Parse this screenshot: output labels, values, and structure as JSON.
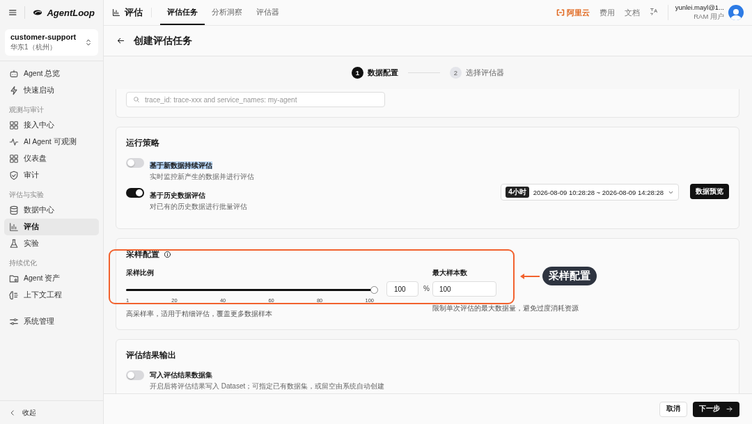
{
  "sidebar": {
    "brand": "AgentLoop",
    "project": {
      "name": "customer-support",
      "region": "华东1（杭州）"
    },
    "sections": [
      {
        "items": [
          {
            "label": "Agent 总览",
            "selected": false
          },
          {
            "label": "快速启动",
            "selected": false
          }
        ]
      },
      {
        "title": "观测与审计",
        "items": [
          {
            "label": "接入中心",
            "selected": false
          },
          {
            "label": "AI Agent 可观测",
            "selected": false
          },
          {
            "label": "仪表盘",
            "selected": false
          },
          {
            "label": "审计",
            "selected": false
          }
        ]
      },
      {
        "title": "评估与实验",
        "items": [
          {
            "label": "数据中心",
            "selected": false
          },
          {
            "label": "评估",
            "selected": true
          },
          {
            "label": "实验",
            "selected": false
          }
        ]
      },
      {
        "title": "持续优化",
        "items": [
          {
            "label": "Agent 资产",
            "selected": false
          },
          {
            "label": "上下文工程",
            "selected": false
          }
        ]
      },
      {
        "items": [
          {
            "label": "系统管理",
            "selected": false
          }
        ]
      }
    ],
    "collapse": "收起"
  },
  "topbar": {
    "section": "评估",
    "tabs": [
      {
        "label": "评估任务",
        "selected": true
      },
      {
        "label": "分析洞察",
        "selected": false
      },
      {
        "label": "评估器",
        "selected": false
      }
    ],
    "cloud_brand": "阿里云",
    "links": [
      "费用",
      "文档"
    ],
    "user": {
      "name": "yunlei.mayl@1...",
      "role": "RAM 用户"
    }
  },
  "page": {
    "title": "创建评估任务",
    "steps": [
      {
        "number": "1",
        "label": "数据配置",
        "selected": true
      },
      {
        "number": "2",
        "label": "选择评估器",
        "selected": false
      }
    ],
    "filter": {
      "placeholder": "trace_id: trace-xxx and service_names: my-agent"
    },
    "run_strategy": {
      "title": "运行策略",
      "options": [
        {
          "label": "基于新数据持续评估",
          "description": "实时监控新产生的数据并进行评估",
          "on": false,
          "text_selected": true
        },
        {
          "label": "基于历史数据评估",
          "description": "对已有的历史数据进行批量评估",
          "on": true,
          "text_selected": false
        }
      ],
      "time_range": {
        "badge": "4小时",
        "value": "2026-08-09 10:28:28 ~ 2026-08-09 14:28:28"
      },
      "preview_button": "数据预览"
    },
    "sampling": {
      "title": "采样配置",
      "ratio_label": "采样比例",
      "level": 1.0,
      "ticks": [
        "1",
        "20",
        "40",
        "60",
        "80",
        "100"
      ],
      "ratio_value": "100",
      "unit": "%",
      "ratio_hint": "高采样率，适用于精细评估，覆盖更多数据样本",
      "max_label": "最大样本数",
      "max_value": "100",
      "max_hint": "限制单次评估的最大数据量，避免过度消耗资源"
    },
    "output": {
      "title": "评估结果输出",
      "label": "写入评估结果数据集",
      "description": "开启后将评估结果写入 Dataset；可指定已有数据集，或留空由系统自动创建",
      "on": false
    },
    "buttons": {
      "cancel": "取消",
      "next": "下一步"
    }
  },
  "annotation": {
    "label": "采样配置"
  }
}
